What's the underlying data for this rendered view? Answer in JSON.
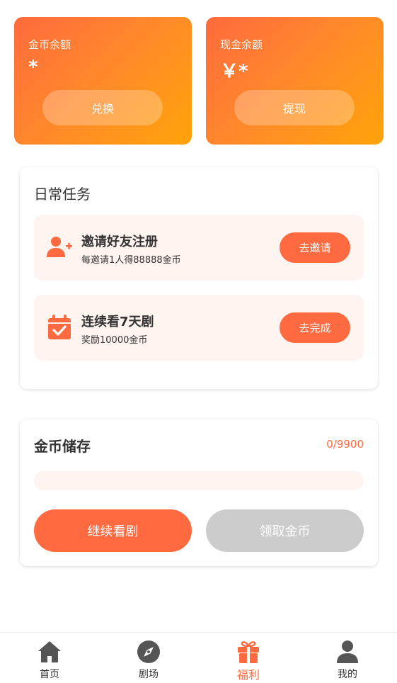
{
  "balances": {
    "coin": {
      "label": "金币余额",
      "value": "*",
      "button": "兑换"
    },
    "cash": {
      "label": "现金余额",
      "value": "￥*",
      "button": "提现"
    }
  },
  "daily_tasks": {
    "title": "日常任务",
    "items": [
      {
        "title": "邀请好友注册",
        "desc": "每邀请1人得88888金币",
        "button": "去邀请",
        "icon": "add-user-icon"
      },
      {
        "title": "连续看7天剧",
        "desc": "奖励10000金币",
        "button": "去完成",
        "icon": "calendar-check-icon"
      }
    ]
  },
  "coin_storage": {
    "title": "金币储存",
    "count": "0/9900",
    "progress": 0,
    "watch_button": "继续看剧",
    "claim_button": "领取金币"
  },
  "bottom_nav": {
    "items": [
      {
        "label": "首页",
        "icon": "home-icon",
        "active": false
      },
      {
        "label": "剧场",
        "icon": "compass-icon",
        "active": false
      },
      {
        "label": "福利",
        "icon": "gift-icon",
        "active": true
      },
      {
        "label": "我的",
        "icon": "user-icon",
        "active": false
      }
    ]
  },
  "colors": {
    "accent": "#ff6a40",
    "gradient_start": "#ff6a3d",
    "gradient_end": "#ffa309",
    "task_bg": "#fff4f0",
    "disabled": "#cccccc",
    "icon_gray": "#555555"
  }
}
